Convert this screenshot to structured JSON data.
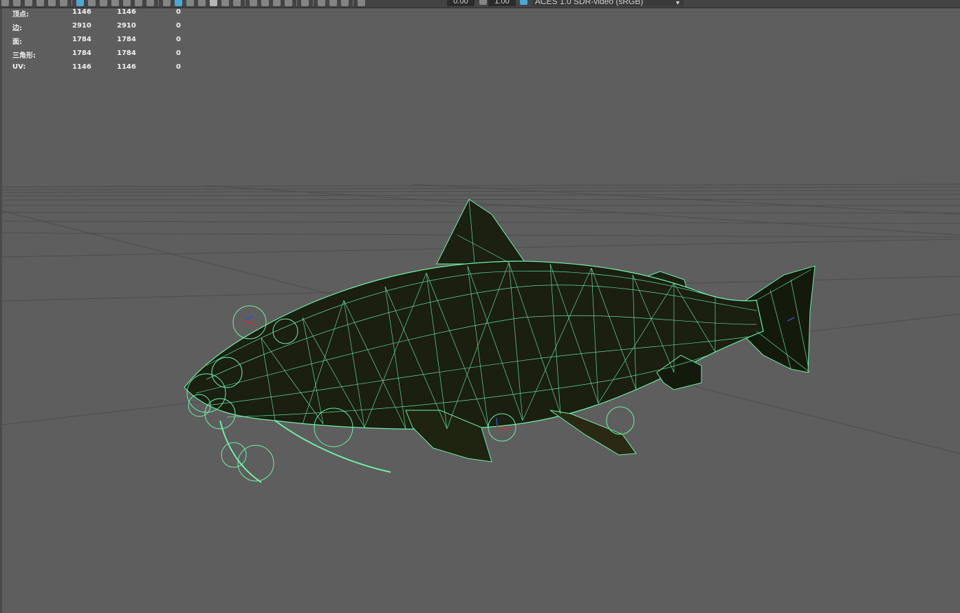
{
  "toolbar": {
    "exposure_value": "0.00",
    "gamma_value": "1.00",
    "color_space": "ACES 1.0 SDR-video (sRGB)"
  },
  "hud": {
    "rows": [
      {
        "label": "顶点:",
        "v1": "1146",
        "v2": "1146",
        "v3": "0"
      },
      {
        "label": "边:",
        "v1": "2910",
        "v2": "2910",
        "v3": "0"
      },
      {
        "label": "面:",
        "v1": "1784",
        "v2": "1784",
        "v3": "0"
      },
      {
        "label": "三角形:",
        "v1": "1784",
        "v2": "1784",
        "v3": "0"
      },
      {
        "label": "UV:",
        "v1": "1146",
        "v2": "1146",
        "v3": "0"
      }
    ]
  },
  "viewport": {
    "background": "#5e5e5e",
    "grid_color": "#4a4a4a",
    "wireframe_color": "#6ff0a8",
    "mesh_fill": "#1a1f0f"
  }
}
